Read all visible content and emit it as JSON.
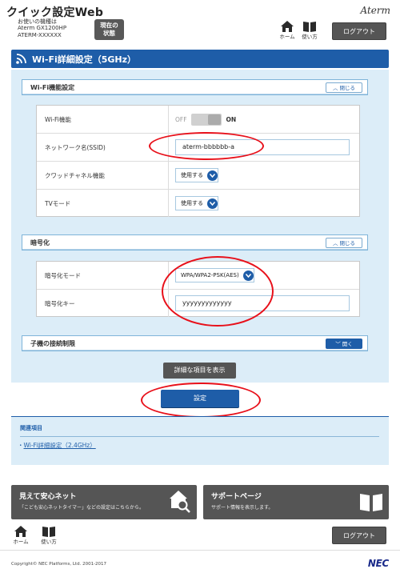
{
  "header": {
    "app_title": "クイック設定Web",
    "device_label": "お使いの機種は",
    "device_model": "Aterm GX1200HP",
    "device_id": "ATERM-XXXXXX",
    "status_button_line1": "現在の",
    "status_button_line2": "状態",
    "brand": "Aterm",
    "home_label": "ホーム",
    "help_label": "使い方",
    "logout_label": "ログアウト"
  },
  "page_title": "Wi-Fi詳細設定（5GHz）",
  "sections": {
    "wifi_function": {
      "title": "Wi-Fi機能設定",
      "toggle_label": "閉じる",
      "rows": {
        "wifi_label": "Wi-Fi機能",
        "wifi_off": "OFF",
        "wifi_on": "ON",
        "ssid_label": "ネットワーク名(SSID)",
        "ssid_value": "aterm-bbbbbb-a",
        "quad_label": "クワッドチャネル機能",
        "quad_value": "使用する",
        "tv_label": "TVモード",
        "tv_value": "使用する"
      }
    },
    "encryption": {
      "title": "暗号化",
      "toggle_label": "閉じる",
      "rows": {
        "mode_label": "暗号化モード",
        "mode_value": "WPA/WPA2-PSK(AES)",
        "key_label": "暗号化キー",
        "key_value": "yyyyyyyyyyyyy"
      }
    },
    "child_limit": {
      "title": "子機の接続制限",
      "toggle_label": "開く"
    }
  },
  "buttons": {
    "show_details": "詳細な項目を表示",
    "submit": "設定"
  },
  "related": {
    "title": "関連項目",
    "bullet": "・",
    "link": "Wi-Fi詳細設定（2.4GHz）"
  },
  "banners": {
    "mieru": {
      "title": "見えて安心ネット",
      "sub": "「こども安心ネットタイマー」などの設定はこちらから。"
    },
    "support": {
      "title": "サポートページ",
      "sub": "サポート情報を表示します。"
    }
  },
  "footer": {
    "home_label": "ホーム",
    "help_label": "使い方",
    "logout_label": "ログアウト",
    "copyright": "Copyright© NEC Platforms, Ltd. 2001-2017",
    "logo": "NEC"
  },
  "colors": {
    "accent": "#1e5da8",
    "panel": "#dcedf8",
    "highlight": "#e8101a",
    "dark_button": "#555555"
  }
}
